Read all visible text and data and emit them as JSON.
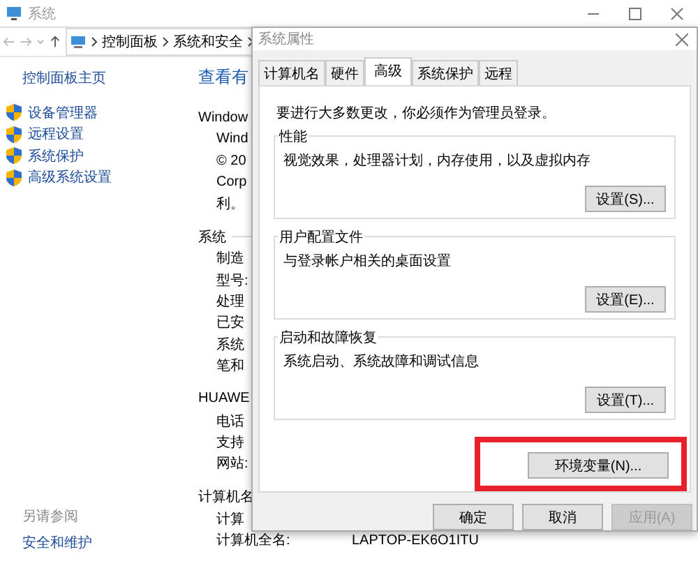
{
  "window": {
    "title": "系统"
  },
  "address_bar": {
    "path": [
      "控制面板",
      "系统和安全"
    ]
  },
  "sidebar": {
    "home": "控制面板主页",
    "items": [
      "设备管理器",
      "远程设置",
      "系统保护",
      "高级系统设置"
    ],
    "see_also": {
      "heading": "另请参阅",
      "links": [
        "安全和维护"
      ]
    }
  },
  "main": {
    "heading": "查看有",
    "sections": [
      {
        "title": "Window",
        "lines": [
          {
            "label": "Wind"
          },
          {
            "label": "© 20"
          },
          {
            "label": "Corp"
          },
          {
            "label": "利。"
          }
        ]
      },
      {
        "title": "系统",
        "lines": [
          {
            "label": "制造"
          },
          {
            "label": "型号:"
          },
          {
            "label": "处理"
          },
          {
            "label": "已安"
          },
          {
            "label": "系统"
          },
          {
            "label": "笔和"
          }
        ]
      },
      {
        "title": "HUAWE",
        "lines": [
          {
            "label": "电话"
          },
          {
            "label": "支持"
          },
          {
            "label": "网站:"
          }
        ]
      },
      {
        "title": "计算机名",
        "lines": [
          {
            "label": "计算"
          },
          {
            "label": "计算机全名:",
            "value": "LAPTOP-EK6O1ITU"
          }
        ]
      }
    ]
  },
  "dialog": {
    "title": "系统属性",
    "tabs": [
      {
        "label": "计算机名",
        "selected": false
      },
      {
        "label": "硬件",
        "selected": false
      },
      {
        "label": "高级",
        "selected": true
      },
      {
        "label": "系统保护",
        "selected": false
      },
      {
        "label": "远程",
        "selected": false
      }
    ],
    "notice": "要进行大多数更改，你必须作为管理员登录。",
    "groups": [
      {
        "title": "性能",
        "description": "视觉效果，处理器计划，内存使用，以及虚拟内存",
        "button": "设置(S)..."
      },
      {
        "title": "用户配置文件",
        "description": "与登录帐户相关的桌面设置",
        "button": "设置(E)..."
      },
      {
        "title": "启动和故障恢复",
        "description": "系统启动、系统故障和调试信息",
        "button": "设置(T)..."
      }
    ],
    "env_button": {
      "label": "环境变量(N)...",
      "highlighted": true
    },
    "buttons": [
      {
        "label": "确定",
        "disabled": false
      },
      {
        "label": "取消",
        "disabled": false
      },
      {
        "label": "应用(A)",
        "disabled": true
      }
    ]
  }
}
